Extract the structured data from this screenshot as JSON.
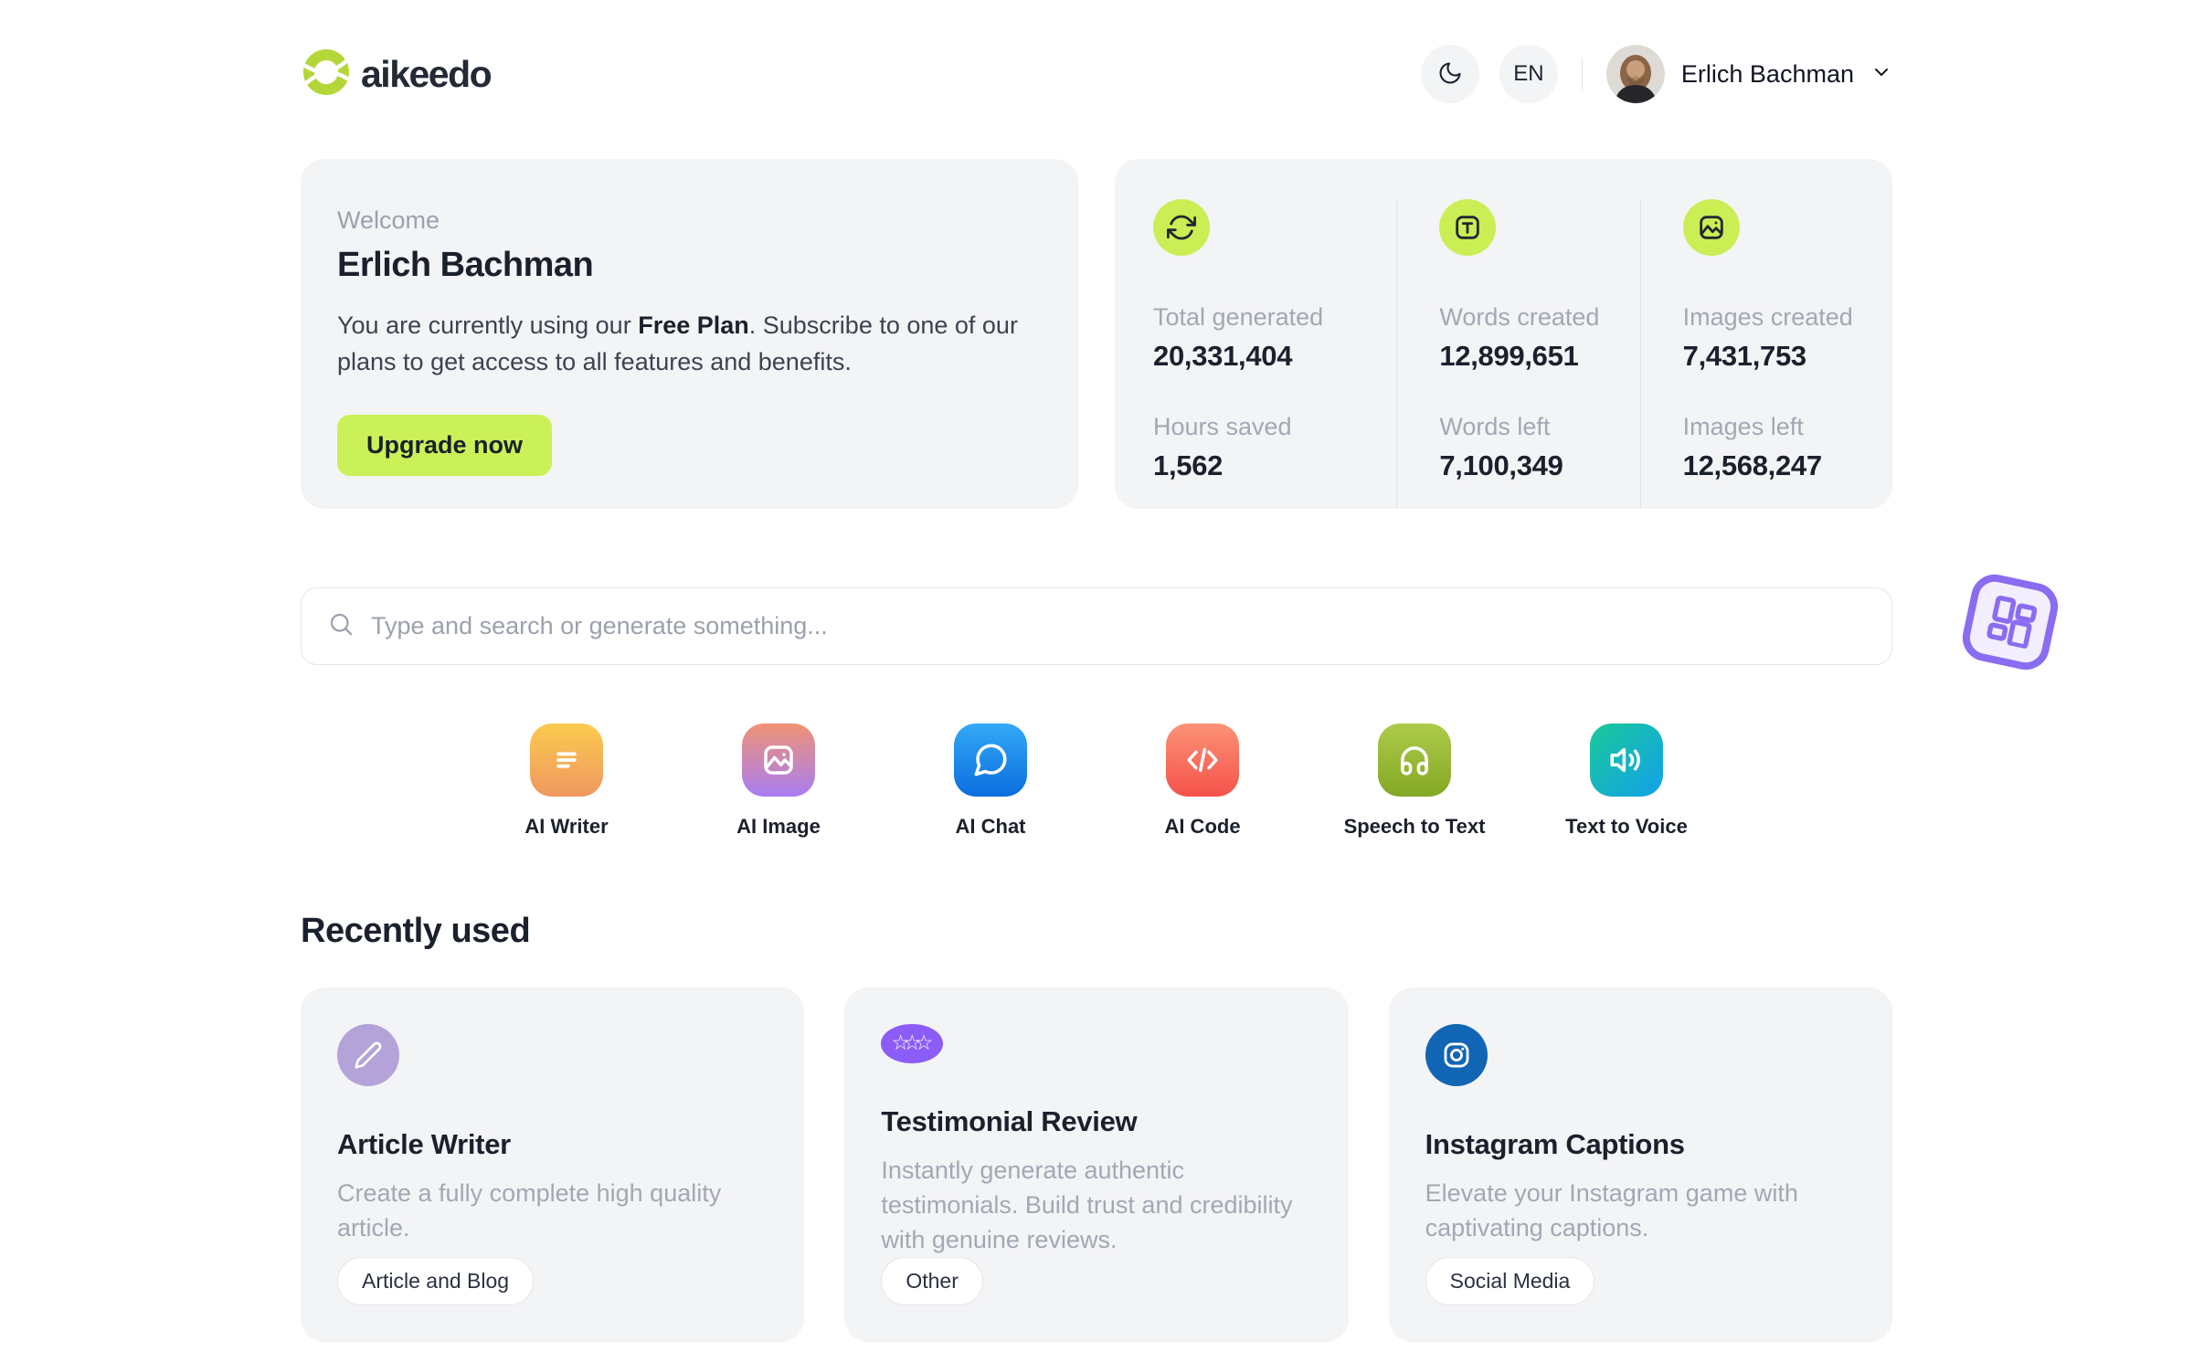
{
  "header": {
    "brand": "aikeedo",
    "language": "EN",
    "user_name": "Erlich Bachman"
  },
  "welcome": {
    "eyebrow": "Welcome",
    "name": "Erlich Bachman",
    "message_pre": "You are currently using our ",
    "plan": "Free Plan",
    "message_post": ". Subscribe to one of our plans to get access to all features and benefits.",
    "cta": "Upgrade now",
    "accent": "#cbf158"
  },
  "stats": {
    "icon_bg": "#cbee55",
    "columns": [
      {
        "icon": "refresh-icon",
        "rows": [
          {
            "label": "Total generated",
            "value": "20,331,404"
          },
          {
            "label": "Hours saved",
            "value": "1,562"
          }
        ]
      },
      {
        "icon": "words-icon",
        "rows": [
          {
            "label": "Words created",
            "value": "12,899,651"
          },
          {
            "label": "Words left",
            "value": "7,100,349"
          }
        ]
      },
      {
        "icon": "images-icon",
        "rows": [
          {
            "label": "Images created",
            "value": "7,431,753"
          },
          {
            "label": "Images left",
            "value": "12,568,247"
          }
        ]
      }
    ]
  },
  "search": {
    "placeholder": "Type and search or generate something..."
  },
  "tools": [
    {
      "label": "AI Writer",
      "icon": "writer-icon",
      "gradient": {
        "from": "#fbcb4e",
        "to": "#ef9760",
        "angle": 180
      }
    },
    {
      "label": "AI Image",
      "icon": "image-icon",
      "gradient": {
        "from": "#ef9375",
        "to": "#a87df2",
        "angle": 180
      }
    },
    {
      "label": "AI Chat",
      "icon": "chat-icon",
      "gradient": {
        "from": "#33a9f7",
        "to": "#0b6ede",
        "angle": 180
      }
    },
    {
      "label": "AI Code",
      "icon": "code-icon",
      "gradient": {
        "from": "#fb9277",
        "to": "#f5524b",
        "angle": 180
      }
    },
    {
      "label": "Speech to Text",
      "icon": "headphones-icon",
      "gradient": {
        "from": "#aecb4b",
        "to": "#83a823",
        "angle": 180
      }
    },
    {
      "label": "Text to Voice",
      "icon": "speaker-icon",
      "gradient": {
        "from": "#1ac998",
        "to": "#12a1ea",
        "angle": 135
      }
    }
  ],
  "recent": {
    "heading": "Recently used",
    "cards": [
      {
        "title": "Article Writer",
        "description": "Create a fully complete high quality article.",
        "tag": "Article and Blog",
        "icon": "pencil-icon",
        "icon_bg": "#b3a3d8"
      },
      {
        "title": "Testimonial Review",
        "description": "Instantly generate authentic testimonials. Build trust and credibility with genuine reviews.",
        "tag": "Other",
        "icon": "stars-icon",
        "icon_bg": "#8b5cf6"
      },
      {
        "title": "Instagram Captions",
        "description": "Elevate your Instagram game with captivating captions.",
        "tag": "Social Media",
        "icon": "instagram-icon",
        "icon_bg": "#1165b5"
      }
    ]
  },
  "floating": {
    "icon": "grid-icon",
    "color": "#8a6cf0"
  }
}
